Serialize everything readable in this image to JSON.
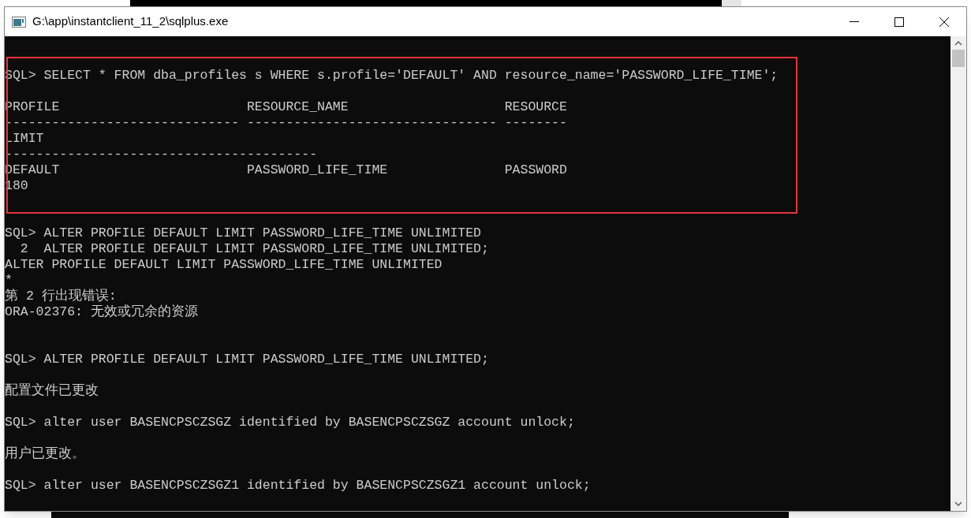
{
  "window": {
    "title": "G:\\app\\instantclient_11_2\\sqlplus.exe"
  },
  "console": {
    "lines": [
      {
        "kind": "blank"
      },
      {
        "kind": "blank"
      },
      {
        "kind": "text",
        "text": "SQL> SELECT * FROM dba_profiles s WHERE s.profile='DEFAULT' AND resource_name='PASSWORD_LIFE_TIME';"
      },
      {
        "kind": "blank"
      },
      {
        "kind": "text",
        "text": "PROFILE                        RESOURCE_NAME                    RESOURCE"
      },
      {
        "kind": "text",
        "text": "------------------------------ -------------------------------- --------"
      },
      {
        "kind": "text",
        "text": "LIMIT"
      },
      {
        "kind": "text",
        "text": "----------------------------------------"
      },
      {
        "kind": "text",
        "text": "DEFAULT                        PASSWORD_LIFE_TIME               PASSWORD"
      },
      {
        "kind": "text",
        "text": "180"
      },
      {
        "kind": "blank"
      },
      {
        "kind": "blank"
      },
      {
        "kind": "text",
        "text": "SQL> ALTER PROFILE DEFAULT LIMIT PASSWORD_LIFE_TIME UNLIMITED"
      },
      {
        "kind": "text",
        "text": "  2  ALTER PROFILE DEFAULT LIMIT PASSWORD_LIFE_TIME UNLIMITED;"
      },
      {
        "kind": "text",
        "text": "ALTER PROFILE DEFAULT LIMIT PASSWORD_LIFE_TIME UNLIMITED"
      },
      {
        "kind": "text",
        "text": "*"
      },
      {
        "kind": "text",
        "text": "第 2 行出现错误:"
      },
      {
        "kind": "text",
        "text": "ORA-02376: 无效或冗余的资源"
      },
      {
        "kind": "blank"
      },
      {
        "kind": "blank"
      },
      {
        "kind": "text",
        "text": "SQL> ALTER PROFILE DEFAULT LIMIT PASSWORD_LIFE_TIME UNLIMITED;"
      },
      {
        "kind": "blank"
      },
      {
        "kind": "text",
        "text": "配置文件已更改"
      },
      {
        "kind": "blank"
      },
      {
        "kind": "text",
        "text": "SQL> alter user BASENCPSCZSGZ identified by BASENCPSCZSGZ account unlock;"
      },
      {
        "kind": "blank"
      },
      {
        "kind": "text",
        "text": "用户已更改。"
      },
      {
        "kind": "blank"
      },
      {
        "kind": "text",
        "text": "SQL> alter user BASENCPSCZSGZ1 identified by BASENCPSCZSGZ1 account unlock;"
      }
    ]
  }
}
